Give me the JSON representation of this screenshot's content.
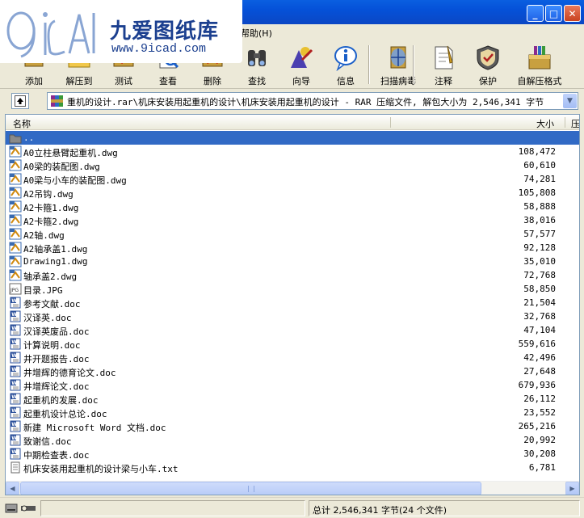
{
  "watermark": {
    "logo_text": "9iCAD",
    "brand_cn": "九爱图纸库",
    "url": "www.9icad.com"
  },
  "window": {
    "minimize": "_",
    "maximize": "□",
    "close": "✕"
  },
  "menu": {
    "help": "帮助(H)"
  },
  "toolbar": [
    {
      "name": "add",
      "label": "添加",
      "icon": "add-archive-icon"
    },
    {
      "name": "extract-to",
      "label": "解压到",
      "icon": "extract-folder-icon"
    },
    {
      "name": "test",
      "label": "测试",
      "icon": "test-archive-icon"
    },
    {
      "name": "view",
      "label": "查看",
      "icon": "view-file-icon"
    },
    {
      "name": "delete",
      "label": "删除",
      "icon": "delete-icon"
    },
    {
      "name": "find",
      "label": "查找",
      "icon": "binoculars-icon"
    },
    {
      "name": "wizard",
      "label": "向导",
      "icon": "wizard-icon"
    },
    {
      "name": "info",
      "label": "信息",
      "icon": "info-icon"
    },
    {
      "name": "virus-scan",
      "label": "扫描病毒",
      "icon": "virus-scan-icon"
    },
    {
      "name": "comment",
      "label": "注释",
      "icon": "comment-icon"
    },
    {
      "name": "protect",
      "label": "保护",
      "icon": "shield-icon"
    },
    {
      "name": "sfx",
      "label": "自解压格式",
      "icon": "sfx-box-icon"
    }
  ],
  "address": {
    "path": "重机的设计.rar\\机床安装用起重机的设计\\机床安装用起重机的设计 - RAR 压缩文件, 解包大小为 2,546,341 字节"
  },
  "list": {
    "headers": {
      "name": "名称",
      "size": "大小",
      "packed": "压"
    },
    "rows": [
      {
        "name": "..",
        "size": "",
        "type": "folder-up",
        "selected": true
      },
      {
        "name": "A0立柱悬臂起重机.dwg",
        "size": "108,472",
        "type": "dwg"
      },
      {
        "name": "A0梁的装配图.dwg",
        "size": "60,610",
        "type": "dwg"
      },
      {
        "name": "A0梁与小车的装配图.dwg",
        "size": "74,281",
        "type": "dwg"
      },
      {
        "name": "A2吊钩.dwg",
        "size": "105,808",
        "type": "dwg"
      },
      {
        "name": "A2卡箍1.dwg",
        "size": "58,888",
        "type": "dwg"
      },
      {
        "name": "A2卡箍2.dwg",
        "size": "38,016",
        "type": "dwg"
      },
      {
        "name": "A2轴.dwg",
        "size": "57,577",
        "type": "dwg"
      },
      {
        "name": "A2轴承盖1.dwg",
        "size": "92,128",
        "type": "dwg"
      },
      {
        "name": "Drawing1.dwg",
        "size": "35,010",
        "type": "dwg"
      },
      {
        "name": "轴承盖2.dwg",
        "size": "72,768",
        "type": "dwg"
      },
      {
        "name": "目录.JPG",
        "size": "58,850",
        "type": "jpg"
      },
      {
        "name": "参考文献.doc",
        "size": "21,504",
        "type": "doc"
      },
      {
        "name": "汉译英.doc",
        "size": "32,768",
        "type": "doc"
      },
      {
        "name": "汉译英废品.doc",
        "size": "47,104",
        "type": "doc"
      },
      {
        "name": "计算说明.doc",
        "size": "559,616",
        "type": "doc"
      },
      {
        "name": "井开题报告.doc",
        "size": "42,496",
        "type": "doc"
      },
      {
        "name": "井增辉的德育论文.doc",
        "size": "27,648",
        "type": "doc"
      },
      {
        "name": "井增辉论文.doc",
        "size": "679,936",
        "type": "doc"
      },
      {
        "name": "起重机的发展.doc",
        "size": "26,112",
        "type": "doc"
      },
      {
        "name": "起重机设计总论.doc",
        "size": "23,552",
        "type": "doc"
      },
      {
        "name": "新建 Microsoft Word 文档.doc",
        "size": "265,216",
        "type": "doc"
      },
      {
        "name": "致谢信.doc",
        "size": "20,992",
        "type": "doc"
      },
      {
        "name": "中期检查表.doc",
        "size": "30,208",
        "type": "doc"
      },
      {
        "name": "机床安装用起重机的设计梁与小车.txt",
        "size": "6,781",
        "type": "txt"
      }
    ]
  },
  "status": {
    "summary": "总计 2,546,341 字节(24 个文件)"
  }
}
